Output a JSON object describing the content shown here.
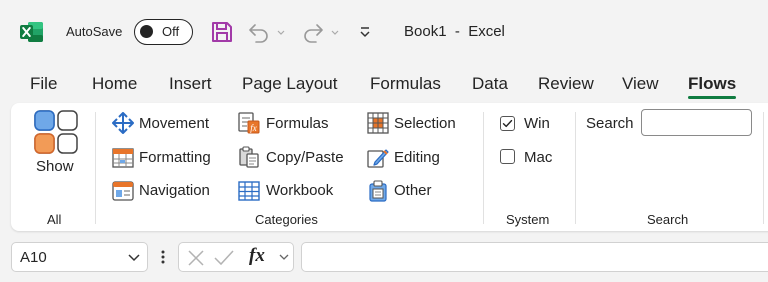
{
  "title_bar": {
    "app_icon": "excel-logo-icon",
    "autosave_label": "AutoSave",
    "autosave_state": "Off",
    "document_title": "Book1  -  Excel",
    "quick_access_icons": [
      "save-icon",
      "undo-icon",
      "redo-icon",
      "customize-quick-access-icon"
    ]
  },
  "tabs": [
    {
      "label": "File"
    },
    {
      "label": "Home"
    },
    {
      "label": "Insert"
    },
    {
      "label": "Page Layout"
    },
    {
      "label": "Formulas"
    },
    {
      "label": "Data"
    },
    {
      "label": "Review"
    },
    {
      "label": "View"
    },
    {
      "label": "Flows",
      "active": true
    }
  ],
  "ribbon": {
    "all_group": {
      "show_label": "Show",
      "group_label": "All",
      "icon": "show-all-grid-icon"
    },
    "categories_group": {
      "group_label": "Categories",
      "items": [
        {
          "label": "Movement",
          "icon": "movement-arrows-icon"
        },
        {
          "label": "Formulas",
          "icon": "formulas-icon"
        },
        {
          "label": "Selection",
          "icon": "selection-grid-icon"
        },
        {
          "label": "Formatting",
          "icon": "formatting-icon"
        },
        {
          "label": "Copy/Paste",
          "icon": "copy-paste-icon"
        },
        {
          "label": "Editing",
          "icon": "editing-pencil-icon"
        },
        {
          "label": "Navigation",
          "icon": "navigation-icon"
        },
        {
          "label": "Workbook",
          "icon": "workbook-icon"
        },
        {
          "label": "Other",
          "icon": "other-icon"
        }
      ]
    },
    "system_group": {
      "group_label": "System",
      "options": [
        {
          "label": "Win",
          "checked": true
        },
        {
          "label": "Mac",
          "checked": false
        }
      ]
    },
    "search_group": {
      "label": "Search",
      "group_label": "Search",
      "value": ""
    }
  },
  "formula_bar": {
    "name_box": "A10",
    "fx_label": "fx",
    "formula_value": ""
  },
  "colors": {
    "accent_green": "#107c41",
    "save_purple": "#a23aa8",
    "icon_blue": "#2b6cc4",
    "icon_orange": "#e8752a"
  }
}
